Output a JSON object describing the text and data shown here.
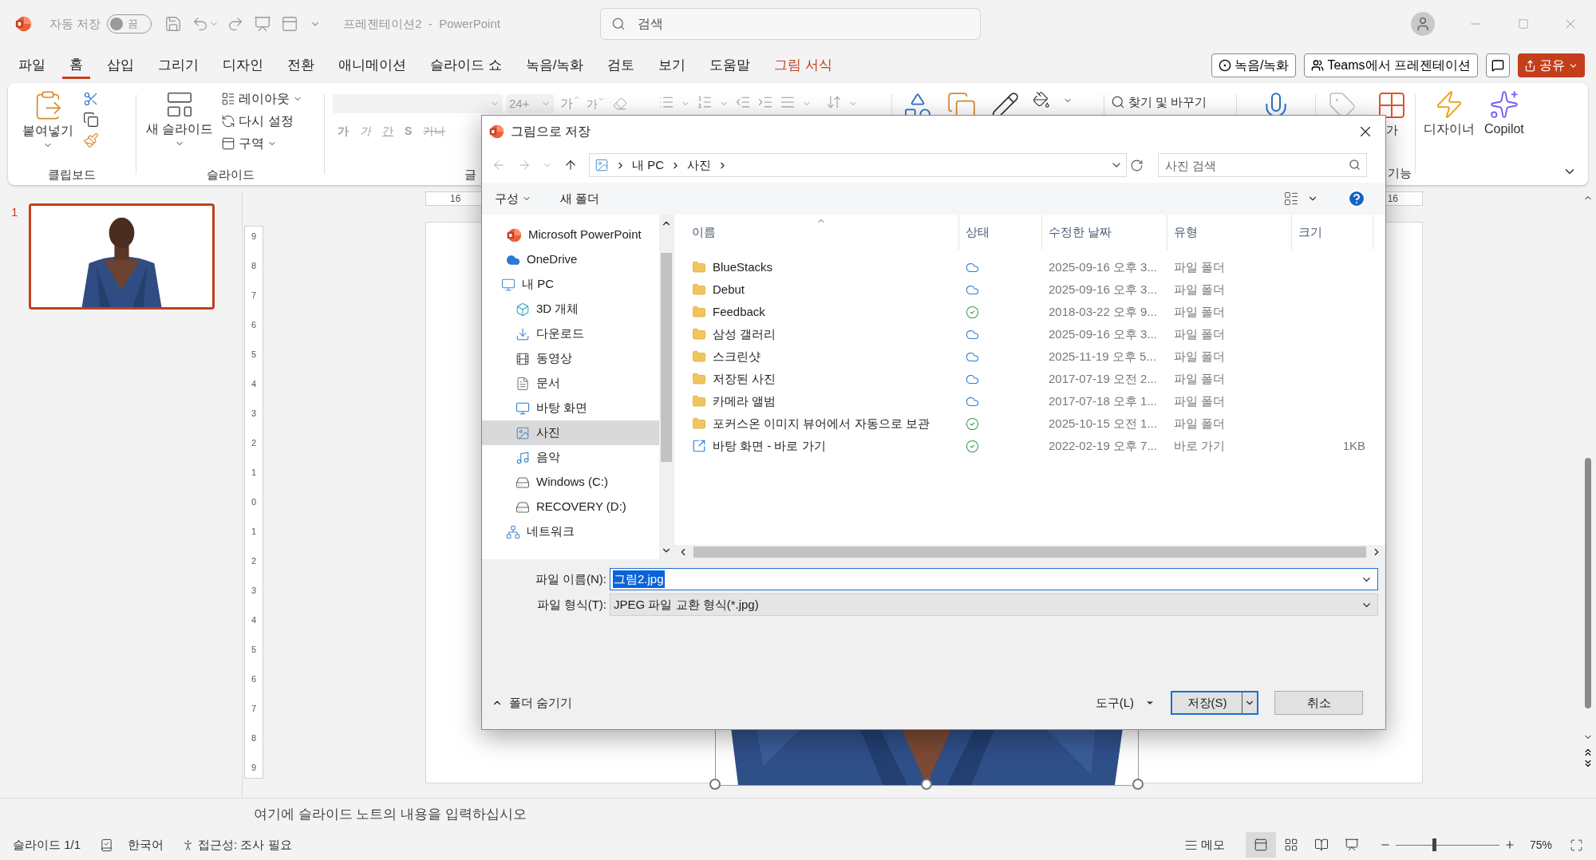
{
  "app_window": {
    "autosave_label": "자동 저장",
    "autosave_on": false,
    "autosave_state": "끔",
    "title": "프레젠테이션2  -  PowerPoint",
    "search_placeholder": "검색"
  },
  "ribbon_tabs": [
    {
      "label": "파일",
      "selected": false,
      "kind": "normal"
    },
    {
      "label": "홈",
      "selected": true,
      "kind": "normal"
    },
    {
      "label": "삽입",
      "selected": false,
      "kind": "normal"
    },
    {
      "label": "그리기",
      "selected": false,
      "kind": "normal"
    },
    {
      "label": "디자인",
      "selected": false,
      "kind": "normal"
    },
    {
      "label": "전환",
      "selected": false,
      "kind": "normal"
    },
    {
      "label": "애니메이션",
      "selected": false,
      "kind": "normal"
    },
    {
      "label": "슬라이드 쇼",
      "selected": false,
      "kind": "normal"
    },
    {
      "label": "녹음/녹화",
      "selected": false,
      "kind": "normal"
    },
    {
      "label": "검토",
      "selected": false,
      "kind": "normal"
    },
    {
      "label": "보기",
      "selected": false,
      "kind": "normal"
    },
    {
      "label": "도움말",
      "selected": false,
      "kind": "normal"
    },
    {
      "label": "그림 서식",
      "selected": false,
      "kind": "contextual"
    }
  ],
  "tab_actions": [
    {
      "kind": "record",
      "label": "녹음/녹화"
    },
    {
      "kind": "teams",
      "label": "Teams에서 프레젠테이션"
    },
    {
      "kind": "comment"
    },
    {
      "kind": "share",
      "label": "공유"
    }
  ],
  "ribbon": {
    "paste": "붙여넣기",
    "clipboard_group": "클립보드",
    "new_slide": "새 슬라이드",
    "layout": "레이아웃",
    "reset": "다시 설정",
    "section": "구역",
    "slides_group": "슬라이드",
    "font_size": "24+",
    "grow_font": "가",
    "shrink_font": "가",
    "format_buttons": [
      {
        "label": "가",
        "kind": "bold"
      },
      {
        "label": "가",
        "kind": "italic"
      },
      {
        "label": "간",
        "kind": "underline"
      },
      {
        "label": "S",
        "kind": "shadow"
      },
      {
        "label": "가나",
        "kind": "strike"
      }
    ],
    "font_group": "글",
    "find_replace": "찾기 및 바꾸기",
    "addins_button": "가",
    "addins_group": "기능",
    "designer": "디자이너",
    "copilot": "Copilot"
  },
  "slide_panel": {
    "slides": [
      {
        "number": "1",
        "selected": true
      }
    ]
  },
  "ruler": {
    "left_label": "16",
    "right_label": "16",
    "vertical": [
      "9",
      "8",
      "7",
      "6",
      "5",
      "4",
      "3",
      "2",
      "1",
      "0",
      "1",
      "2",
      "3",
      "4",
      "5",
      "6",
      "7",
      "8",
      "9"
    ]
  },
  "notes_placeholder": "여기에 슬라이드 노트의 내용을 입력하십시오",
  "status_bar": {
    "slide": "슬라이드 1/1",
    "language": "한국어",
    "accessibility": "접근성: 조사 필요",
    "notes": "메모",
    "views": [
      {
        "kind": "normal",
        "selected": true
      },
      {
        "kind": "sorter",
        "selected": false
      },
      {
        "kind": "reading",
        "selected": false
      },
      {
        "kind": "slideshow",
        "selected": false
      }
    ],
    "zoom_slider": {
      "level": 0.37
    },
    "zoom": "75%"
  },
  "dialog": {
    "title": "그림으로 저장",
    "breadcrumb": [
      "내 PC",
      "사진"
    ],
    "search_placeholder": "사진 검색",
    "organize": "구성",
    "new_folder": "새 폴더",
    "nav": [
      {
        "label": "Microsoft PowerPoint",
        "kind": "powerpoint",
        "selected": false
      },
      {
        "label": "OneDrive",
        "kind": "onedrive",
        "selected": false
      },
      {
        "label": "내 PC",
        "kind": "pc",
        "selected": false,
        "children": [
          {
            "label": "3D 개체",
            "kind": "objects3d",
            "selected": false
          },
          {
            "label": "다운로드",
            "kind": "download",
            "selected": false
          },
          {
            "label": "동영상",
            "kind": "video",
            "selected": false
          },
          {
            "label": "문서",
            "kind": "documents",
            "selected": false
          },
          {
            "label": "바탕 화면",
            "kind": "desktop",
            "selected": false
          },
          {
            "label": "사진",
            "kind": "pictures",
            "selected": true
          },
          {
            "label": "음악",
            "kind": "music",
            "selected": false
          },
          {
            "label": "Windows (C:)",
            "kind": "drive",
            "selected": false
          },
          {
            "label": "RECOVERY (D:)",
            "kind": "drive",
            "selected": false
          }
        ]
      },
      {
        "label": "네트워크",
        "kind": "network",
        "selected": false
      }
    ],
    "columns": [
      {
        "label": "이름",
        "sorted": true
      },
      {
        "label": "상태",
        "sorted": false
      },
      {
        "label": "수정한 날짜",
        "sorted": false
      },
      {
        "label": "유형",
        "sorted": false
      },
      {
        "label": "크기",
        "sorted": false
      }
    ],
    "rows": [
      {
        "name": "BlueStacks",
        "kind": "folder",
        "synced": false,
        "modified": "2025-09-16 오후 3...",
        "type": "파일 폴더"
      },
      {
        "name": "Debut",
        "kind": "folder",
        "synced": false,
        "modified": "2025-09-16 오후 3...",
        "type": "파일 폴더"
      },
      {
        "name": "Feedback",
        "kind": "folder",
        "synced": true,
        "modified": "2018-03-22 오후 9...",
        "type": "파일 폴더"
      },
      {
        "name": "삼성 갤러리",
        "kind": "folder",
        "synced": false,
        "modified": "2025-09-16 오후 3...",
        "type": "파일 폴더"
      },
      {
        "name": "스크린샷",
        "kind": "folder",
        "synced": false,
        "modified": "2025-11-19 오후 5...",
        "type": "파일 폴더"
      },
      {
        "name": "저장된 사진",
        "kind": "folder",
        "synced": false,
        "modified": "2017-07-19 오전 2...",
        "type": "파일 폴더"
      },
      {
        "name": "카메라 앨범",
        "kind": "folder",
        "synced": false,
        "modified": "2017-07-18 오후 1...",
        "type": "파일 폴더"
      },
      {
        "name": "포커스온 이미지 뷰어에서 자동으로 보관",
        "kind": "folder",
        "synced": true,
        "modified": "2025-10-15 오전 1...",
        "type": "파일 폴더"
      },
      {
        "name": "바탕 화면 - 바로 가기",
        "kind": "shortcut",
        "synced": true,
        "modified": "2022-02-19 오후 7...",
        "type": "바로 가기",
        "size": "1KB"
      }
    ],
    "file_name": {
      "label": "파일 이름(N):",
      "value": "그림2.jpg"
    },
    "file_type": {
      "label": "파일 형식(T):",
      "value": "JPEG 파일 교환 형식(*.jpg)"
    },
    "hide_folders": "폴더 숨기기",
    "tools": "도구(L)",
    "save": "저장(S)",
    "cancel": "취소"
  }
}
